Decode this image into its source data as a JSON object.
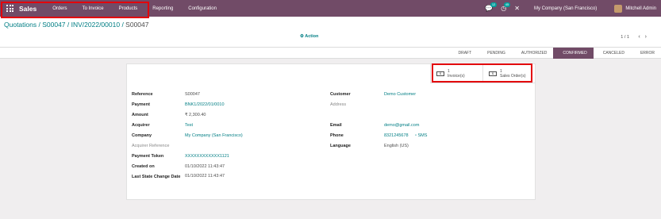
{
  "topbar": {
    "app_name": "Sales",
    "menu": [
      "Orders",
      "To Invoice",
      "Products",
      "Reporting",
      "Configuration"
    ],
    "chat_count": "12",
    "activity_count": "45",
    "company": "My Company (San Francisco)",
    "user": "Mitchell Admin"
  },
  "control": {
    "breadcrumb": [
      "Quotations",
      "S00047",
      "INV/2022/00010"
    ],
    "current": "S00047",
    "action": "Action",
    "pager": "1 / 1"
  },
  "status": {
    "steps": [
      "DRAFT",
      "PENDING",
      "AUTHORIZED",
      "CONFIRMED",
      "CANCELED",
      "ERROR"
    ],
    "active": "CONFIRMED"
  },
  "smart_buttons": [
    {
      "count": "1",
      "label": "Invoice(s)"
    },
    {
      "count": "1",
      "label": "Sales Order(s)"
    }
  ],
  "left_fields": [
    {
      "label": "Reference",
      "value": "S00047"
    },
    {
      "label": "Payment",
      "value": "BNK1/2022/01/0010"
    },
    {
      "label": "Amount",
      "value": "₹ 2,300.40"
    },
    {
      "label": "Acquirer",
      "value": "Test"
    },
    {
      "label": "Company",
      "value": "My Company (San Francisco)"
    },
    {
      "label": "Acquirer Reference",
      "value": ""
    },
    {
      "label": "Payment Token",
      "value": "XXXXXXXXXXXX1121"
    },
    {
      "label": "Created on",
      "value": "01/10/2022 11:43:47"
    },
    {
      "label": "Last State Change Date",
      "value": "01/10/2022 11:43:47"
    }
  ],
  "right_fields": [
    {
      "label": "Customer",
      "value": "Demo Customer"
    },
    {
      "label": "Address",
      "value": ""
    },
    {
      "label": "Email",
      "value": "demo@gmail.com"
    },
    {
      "label": "Phone",
      "value": "8321245678"
    },
    {
      "label": "Language",
      "value": "English (US)"
    }
  ],
  "sms_label": "SMS"
}
